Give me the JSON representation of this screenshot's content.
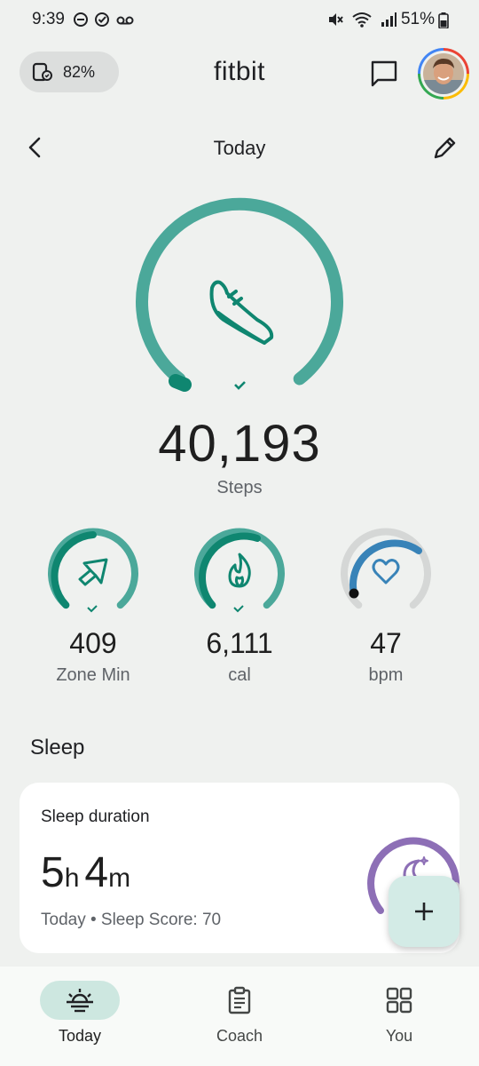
{
  "status_bar": {
    "time": "9:39",
    "battery": "51%"
  },
  "header": {
    "device_battery": "82%",
    "logo": "fitbit"
  },
  "date_nav": {
    "title": "Today"
  },
  "steps": {
    "value": "40,193",
    "label": "Steps",
    "progress": 1.0
  },
  "metrics": [
    {
      "value": "409",
      "label": "Zone Min",
      "icon": "zone-arrow-icon",
      "progress": 1.0
    },
    {
      "value": "6,111",
      "label": "cal",
      "icon": "flame-icon",
      "progress": 1.0
    },
    {
      "value": "47",
      "label": "bpm",
      "icon": "heart-icon"
    }
  ],
  "sleep": {
    "section_title": "Sleep",
    "card_title": "Sleep duration",
    "hours": "5",
    "hours_unit": "h",
    "minutes": "4",
    "minutes_unit": "m",
    "subtitle": "Today • Sleep Score: 70",
    "score": 70
  },
  "bottom_nav": [
    {
      "label": "Today",
      "icon": "sunrise-icon",
      "active": true
    },
    {
      "label": "Coach",
      "icon": "clipboard-icon",
      "active": false
    },
    {
      "label": "You",
      "icon": "grid-icon",
      "active": false
    }
  ],
  "colors": {
    "teal": "#4ba89a",
    "teal_dark": "#0f8670",
    "blue": "#3883b8",
    "purple": "#8d6fb6",
    "background": "#eff1ef"
  }
}
